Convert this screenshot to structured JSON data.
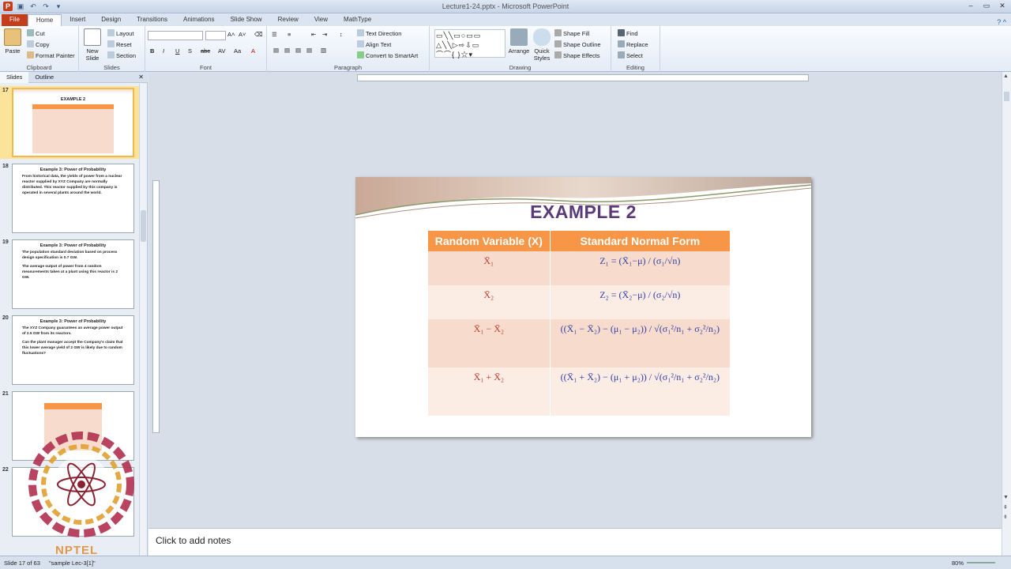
{
  "window": {
    "title": "Lecture1-24.pptx - Microsoft PowerPoint"
  },
  "qat": {
    "app_icon_letter": "P"
  },
  "window_controls": {
    "minimize": "–",
    "maximize": "▭",
    "close": "✕"
  },
  "tabs": [
    "File",
    "Home",
    "Insert",
    "Design",
    "Transitions",
    "Animations",
    "Slide Show",
    "Review",
    "View",
    "MathType"
  ],
  "tabs_help": "? ^",
  "ribbon": {
    "clipboard": {
      "label": "Clipboard",
      "paste": "Paste",
      "cut": "Cut",
      "copy": "Copy",
      "format_painter": "Format Painter"
    },
    "slides": {
      "label": "Slides",
      "new_slide": "New Slide",
      "layout": "Layout",
      "reset": "Reset",
      "section": "Section"
    },
    "font": {
      "label": "Font",
      "bold": "B",
      "italic": "I",
      "underline": "U",
      "strike": "S",
      "shadow": "abc",
      "spacing": "AV",
      "case": "Aa",
      "color": "A"
    },
    "paragraph": {
      "label": "Paragraph",
      "text_direction": "Text Direction",
      "align_text": "Align Text",
      "convert_smartart": "Convert to SmartArt"
    },
    "drawing": {
      "label": "Drawing",
      "arrange": "Arrange",
      "quick_styles": "Quick Styles",
      "shape_fill": "Shape Fill",
      "shape_outline": "Shape Outline",
      "shape_effects": "Shape Effects"
    },
    "editing": {
      "label": "Editing",
      "find": "Find",
      "replace": "Replace",
      "select": "Select"
    }
  },
  "panel": {
    "tab_slides": "Slides",
    "tab_outline": "Outline",
    "close": "✕"
  },
  "thumbnails": [
    {
      "num": "17",
      "title": "EXAMPLE 2",
      "lines": []
    },
    {
      "num": "18",
      "title": "Example 3: Power of Probability",
      "lines": [
        "From historical data, the yields of power from a nuclear reactor supplied by XYZ Company are normally distributed. This reactor supplied by this company is operated in several plants around the world."
      ]
    },
    {
      "num": "19",
      "title": "Example 3: Power of Probability",
      "lines": [
        "The population standard deviation based on process design specification is 0.7 GW.",
        "The average output of power from 4 random measurements taken at a plant using this reactor is 2 GW."
      ]
    },
    {
      "num": "20",
      "title": "Example 3: Power of Probability",
      "lines": [
        "The XYZ Company guarantees an average power output of 2.5 GW from its reactors.",
        "Can the plant manager accept the Company's claim that this lower average yield of 2 GW is likely due to random fluctuations?"
      ]
    },
    {
      "num": "21",
      "title": "",
      "lines": []
    },
    {
      "num": "22",
      "title": "",
      "lines": []
    }
  ],
  "slide": {
    "title": "EXAMPLE 2",
    "table": {
      "headers": [
        "Random Variable (X)",
        "Standard Normal Form"
      ],
      "rows": [
        {
          "var": "X̄₁",
          "form": "Z₁ = (X̄₁−μ) / (σ₁/√n)"
        },
        {
          "var": "X̄₂",
          "form": "Z₂ = (X̄₂−μ) / (σ₂/√n)"
        },
        {
          "var": "X̄₁ − X̄₂",
          "form": "((X̄₁ − X̄₂) − (μ₁ − μ₂)) / √(σ₁²/n₁ + σ₂²/n₂)"
        },
        {
          "var": "X̄₁ + X̄₂",
          "form": "((X̄₁ + X̄₂) − (μ₁ + μ₂)) / √(σ₁²/n₁ + σ₂²/n₂)"
        }
      ]
    }
  },
  "notes": {
    "placeholder": "Click to add notes"
  },
  "status": {
    "slide_count": "Slide 17 of 63",
    "theme": "\"sample Lec-3[1]\"",
    "zoom": "80%"
  },
  "watermark": {
    "text": "NPTEL"
  },
  "colors": {
    "header_orange": "#f79646",
    "title_purple": "#5b3a7a",
    "formula_blue": "#2f3fa8",
    "var_red": "#c0392b",
    "thumb_selected": "#fbe39a",
    "file_tab": "#c43e1c"
  }
}
